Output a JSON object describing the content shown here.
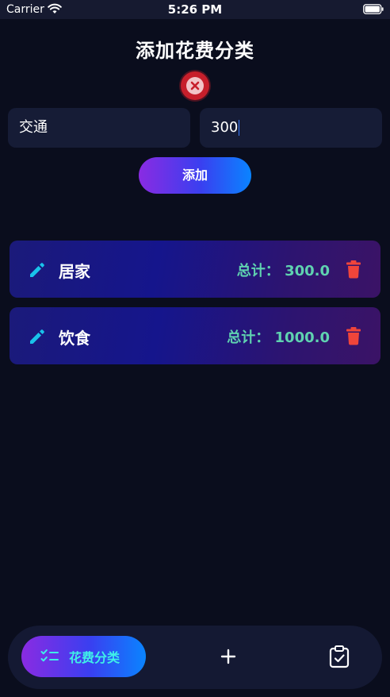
{
  "status_bar": {
    "carrier": "Carrier",
    "time": "5:26 PM"
  },
  "page": {
    "title": "添加花费分类"
  },
  "form": {
    "name_value": "交通",
    "amount_value": "300",
    "add_label": "添加"
  },
  "categories": [
    {
      "name": "居家",
      "total": "总计：  300.0"
    },
    {
      "name": "饮食",
      "total": "总计：  1000.0"
    }
  ],
  "tab_bar": {
    "active_label": "花费分类"
  },
  "icons": {
    "status": [
      "wifi-icon",
      "battery-icon"
    ],
    "close": "close-circle-icon",
    "edit": "pencil-icon",
    "delete": "trash-icon",
    "tabs": [
      "checklist-icon",
      "plus-icon",
      "clipboard-check-icon"
    ]
  },
  "colors": {
    "background": "#0a0d1d",
    "accent_gradient_start": "#8a2be2",
    "accent_gradient_end": "#0a84ff",
    "total_text": "#5fd2b0",
    "edit_icon": "#19c3ea",
    "delete_icon": "#f0453a",
    "close_button": "#c71f2b",
    "tab_active_text": "#3ff0e8"
  }
}
